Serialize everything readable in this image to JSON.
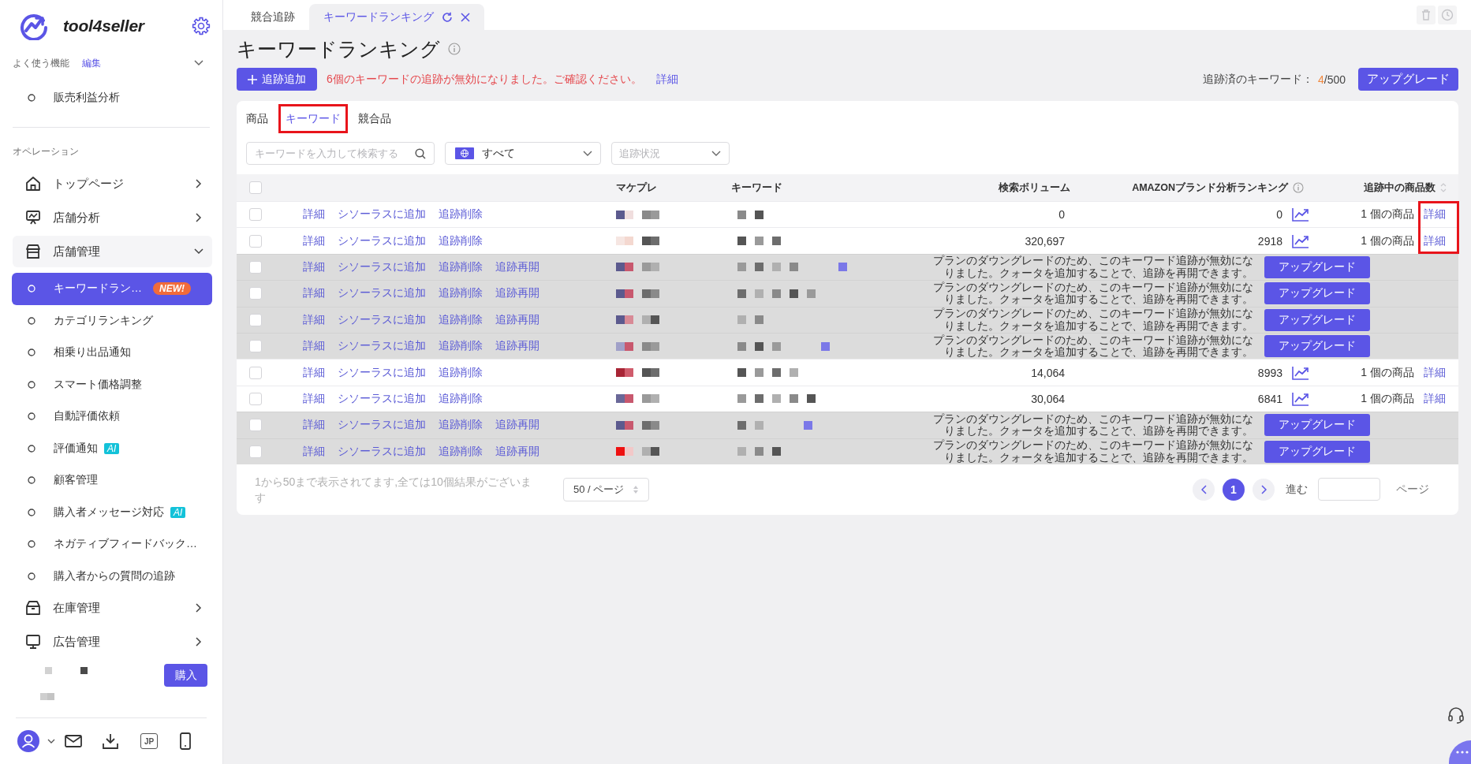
{
  "top_tabs": [
    {
      "label": "競合追跡",
      "selected": false
    },
    {
      "label": "キーワードランキング",
      "selected": true
    }
  ],
  "sidebar": {
    "brand": "tool4seller",
    "favorites": {
      "label": "よく使う機能",
      "edit_link": "編集",
      "expanded": true,
      "items": [
        {
          "label": "販売利益分析"
        }
      ]
    },
    "section_label": "オペレーション",
    "menu": [
      {
        "label": "トップページ",
        "expanded": false
      },
      {
        "label": "店舗分析",
        "expanded": false
      },
      {
        "label": "店舗管理",
        "expanded": true,
        "children": [
          {
            "label": "キーワードラン…",
            "selected": true,
            "badge": {
              "kind": "new",
              "text": "NEW!"
            }
          },
          {
            "label": "カテゴリランキング",
            "selected": false
          },
          {
            "label": "相乗り出品通知",
            "selected": false
          },
          {
            "label": "スマート価格調整",
            "selected": false
          },
          {
            "label": "自動評価依頼",
            "selected": false
          },
          {
            "label": "評価通知",
            "selected": false,
            "badge": {
              "kind": "ai",
              "text": "AI"
            }
          },
          {
            "label": "顧客管理",
            "selected": false
          },
          {
            "label": "購入者メッセージ対応",
            "selected": false,
            "badge": {
              "kind": "ai",
              "text": "AI"
            }
          },
          {
            "label": "ネガティブフィードバック…",
            "selected": false
          },
          {
            "label": "購入者からの質問の追跡",
            "selected": false
          }
        ]
      },
      {
        "label": "在庫管理",
        "expanded": false
      },
      {
        "label": "広告管理",
        "expanded": false
      }
    ],
    "buy_button": "購入",
    "language": "JP"
  },
  "page": {
    "title": "キーワードランキング",
    "add_button": "追跡追加",
    "alert": "6個のキーワードの追跡が無効になりました。ご確認ください。",
    "alert_link": "詳細",
    "quota_label": "追跡済のキーワード：",
    "quota_used": "4",
    "quota_total": "/500",
    "upgrade_button": "アップグレード"
  },
  "content_tabs": [
    {
      "label": "商品",
      "selected": false,
      "highlighted": false
    },
    {
      "label": "キーワード",
      "selected": true,
      "highlighted": true
    },
    {
      "label": "競合品",
      "selected": false,
      "highlighted": false
    }
  ],
  "filters": {
    "search_placeholder": "キーワードを入力して検索する",
    "marketplace": "すべて",
    "status_placeholder": "追跡状況"
  },
  "table": {
    "all_checked": false,
    "columns": [
      {
        "label": "マケプレ",
        "sortable": false
      },
      {
        "label": "キーワード",
        "sortable": false
      },
      {
        "label": "検索ボリューム",
        "sortable": false
      },
      {
        "label": "AMAZONブランド分析ランキング",
        "sortable": false
      },
      {
        "label": "追跡中の商品数",
        "sortable": true
      }
    ],
    "rows": [
      {
        "kind": "active",
        "checked": false,
        "highlighted": true,
        "actions": [
          "詳細",
          "シソーラスに追加",
          "追跡削除"
        ],
        "search_volume": "0",
        "ranking": "0",
        "tracked_products": "1 個の商品",
        "detail_link": "詳細"
      },
      {
        "kind": "active",
        "checked": false,
        "highlighted": true,
        "actions": [
          "詳細",
          "シソーラスに追加",
          "追跡削除"
        ],
        "search_volume": "320,697",
        "ranking": "2918",
        "tracked_products": "1 個の商品",
        "detail_link": "詳細"
      },
      {
        "kind": "disabled",
        "checked": false,
        "highlighted": false,
        "actions": [
          "詳細",
          "シソーラスに追加",
          "追跡削除",
          "追跡再開"
        ],
        "notice": "プランのダウングレードのため、このキーワード追跡が無効になりました。クォータを追加することで、追跡を再開できます。",
        "upgrade_button": "アップグレード"
      },
      {
        "kind": "disabled",
        "checked": false,
        "highlighted": false,
        "actions": [
          "詳細",
          "シソーラスに追加",
          "追跡削除",
          "追跡再開"
        ],
        "notice": "プランのダウングレードのため、このキーワード追跡が無効になりました。クォータを追加することで、追跡を再開できます。",
        "upgrade_button": "アップグレード"
      },
      {
        "kind": "disabled",
        "checked": false,
        "highlighted": false,
        "actions": [
          "詳細",
          "シソーラスに追加",
          "追跡削除",
          "追跡再開"
        ],
        "notice": "プランのダウングレードのため、このキーワード追跡が無効になりました。クォータを追加することで、追跡を再開できます。",
        "upgrade_button": "アップグレード"
      },
      {
        "kind": "disabled",
        "checked": false,
        "highlighted": false,
        "actions": [
          "詳細",
          "シソーラスに追加",
          "追跡削除",
          "追跡再開"
        ],
        "notice": "プランのダウングレードのため、このキーワード追跡が無効になりました。クォータを追加することで、追跡を再開できます。",
        "upgrade_button": "アップグレード"
      },
      {
        "kind": "active",
        "checked": false,
        "highlighted": false,
        "actions": [
          "詳細",
          "シソーラスに追加",
          "追跡削除"
        ],
        "search_volume": "14,064",
        "ranking": "8993",
        "tracked_products": "1 個の商品",
        "detail_link": "詳細"
      },
      {
        "kind": "active",
        "checked": false,
        "highlighted": false,
        "actions": [
          "詳細",
          "シソーラスに追加",
          "追跡削除"
        ],
        "search_volume": "30,064",
        "ranking": "6841",
        "tracked_products": "1 個の商品",
        "detail_link": "詳細"
      },
      {
        "kind": "disabled",
        "checked": false,
        "highlighted": false,
        "actions": [
          "詳細",
          "シソーラスに追加",
          "追跡削除",
          "追跡再開"
        ],
        "notice": "プランのダウングレードのため、このキーワード追跡が無効になりました。クォータを追加することで、追跡を再開できます。",
        "upgrade_button": "アップグレード"
      },
      {
        "kind": "disabled",
        "checked": false,
        "highlighted": false,
        "actions": [
          "詳細",
          "シソーラスに追加",
          "追跡削除",
          "追跡再開"
        ],
        "notice": "プランのダウングレードのため、このキーワード追跡が無効になりました。クォータを追加することで、追跡を再開できます。",
        "upgrade_button": "アップグレード"
      }
    ]
  },
  "pagination": {
    "summary": "1から50まで表示されてます,全ては10個結果がございます",
    "page_size": "50 / ページ",
    "pages": [
      {
        "label": "1",
        "selected": true
      }
    ],
    "goto_label": "進む",
    "page_suffix": "ページ"
  }
}
